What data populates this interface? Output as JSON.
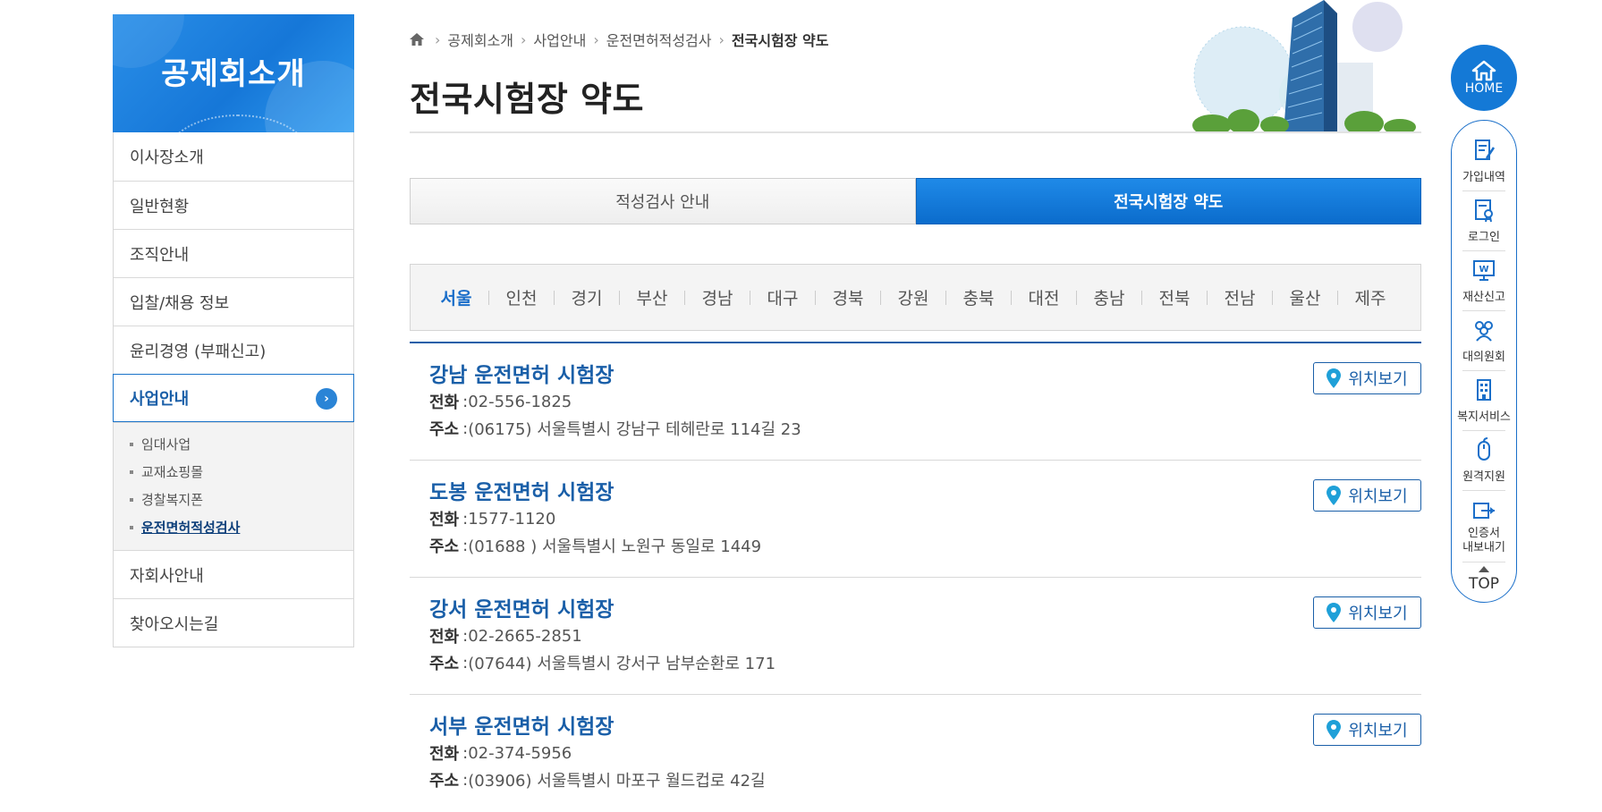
{
  "sidebar": {
    "title": "공제회소개",
    "items": [
      {
        "label": "이사장소개"
      },
      {
        "label": "일반현황"
      },
      {
        "label": "조직안내"
      },
      {
        "label": "입찰/채용 정보"
      },
      {
        "label": "윤리경영 (부패신고)"
      },
      {
        "label": "사업안내"
      },
      {
        "label": "자회사안내"
      },
      {
        "label": "찾아오시는길"
      }
    ],
    "sub_items": [
      {
        "label": "임대사업"
      },
      {
        "label": "교재쇼핑몰"
      },
      {
        "label": "경찰복지폰"
      },
      {
        "label": "운전면허적성검사"
      }
    ]
  },
  "breadcrumb": [
    "공제회소개",
    "사업안내",
    "운전면허적성검사",
    "전국시험장 약도"
  ],
  "page_title": "전국시험장 약도",
  "tabs": [
    {
      "label": "적성검사 안내"
    },
    {
      "label": "전국시험장 약도"
    }
  ],
  "regions": [
    "서울",
    "인천",
    "경기",
    "부산",
    "경남",
    "대구",
    "경북",
    "강원",
    "충북",
    "대전",
    "충남",
    "전북",
    "전남",
    "울산",
    "제주"
  ],
  "selected_region": "서울",
  "labels": {
    "phone": "전화",
    "address": "주소",
    "location_button": "위치보기"
  },
  "sites": [
    {
      "name": "강남 운전면허 시험장",
      "phone": "02-556-1825",
      "address": "(06175) 서울특별시 강남구 테헤란로 114길 23"
    },
    {
      "name": "도봉 운전면허 시험장",
      "phone": "1577-1120",
      "address": "(01688 ) 서울특별시 노원구 동일로 1449"
    },
    {
      "name": "강서 운전면허 시험장",
      "phone": "02-2665-2851",
      "address": "(07644) 서울특별시 강서구 남부순환로 171"
    },
    {
      "name": "서부 운전면허 시험장",
      "phone": "02-374-5956",
      "address": "(03906) 서울특별시 마포구 월드컵로 42길"
    }
  ],
  "quick_menu": {
    "home": "HOME",
    "items": [
      {
        "label": "가입내역",
        "icon": "document-edit-icon"
      },
      {
        "label": "로그인",
        "icon": "certificate-icon"
      },
      {
        "label": "재산신고",
        "icon": "won-monitor-icon"
      },
      {
        "label": "대의원회",
        "icon": "people-icon"
      },
      {
        "label": "복지서비스",
        "icon": "building-icon"
      },
      {
        "label": "원격지원",
        "icon": "mouse-icon"
      },
      {
        "label": "인증서\n내보내기",
        "icon": "export-icon"
      }
    ],
    "top": "TOP"
  },
  "colors": {
    "primary": "#1a5fa8",
    "tab_active": "#0b6ccc",
    "home_circle": "#1479d6"
  }
}
